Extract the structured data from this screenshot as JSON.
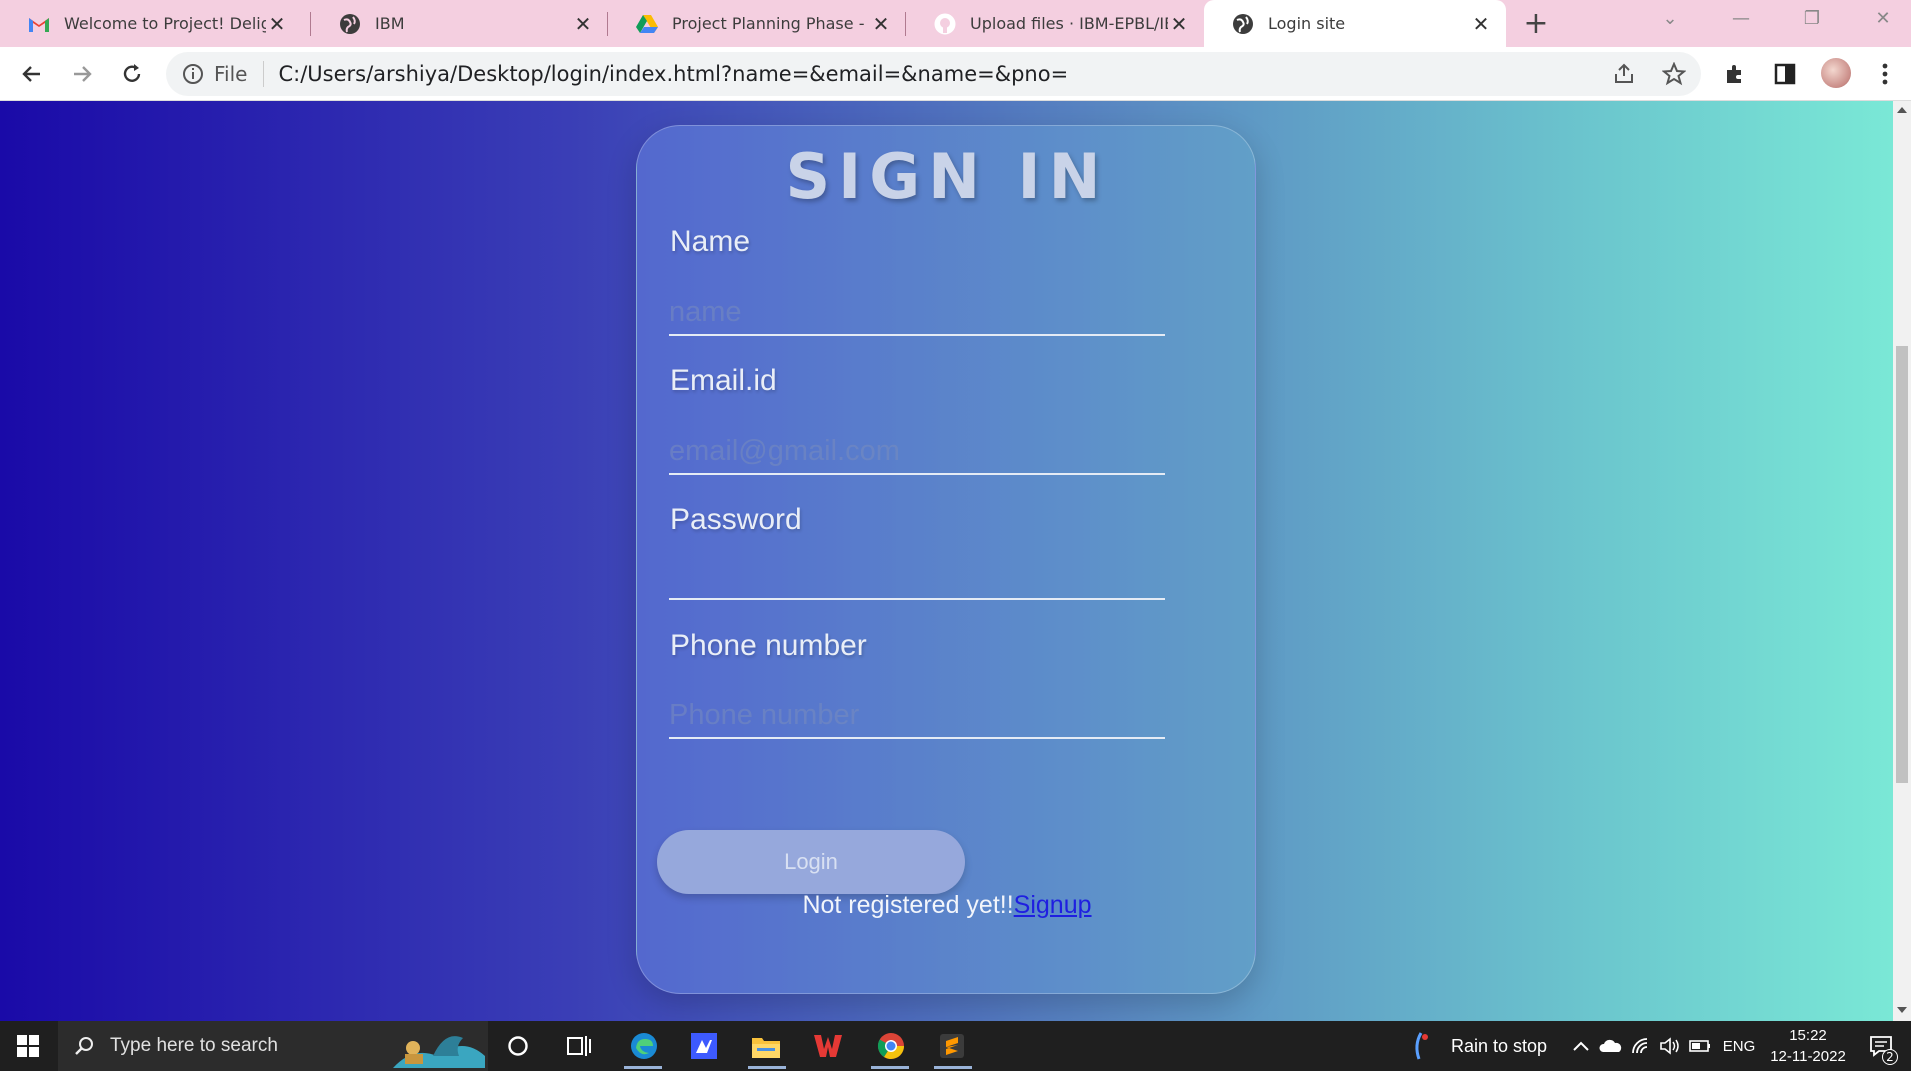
{
  "browser": {
    "tabs": [
      {
        "title": "Welcome to Project! Delighte",
        "favicon": "gmail-icon",
        "active": false
      },
      {
        "title": "IBM",
        "favicon": "globe-icon",
        "active": false
      },
      {
        "title": "Project Planning Phase - Goo",
        "favicon": "google-drive-icon",
        "active": false
      },
      {
        "title": "Upload files · IBM-EPBL/IBM-",
        "favicon": "github-icon",
        "active": false
      },
      {
        "title": "Login site",
        "favicon": "globe-icon",
        "active": true
      }
    ],
    "omnibox": {
      "scheme_label": "File",
      "url": "C:/Users/arshiya/Desktop/login/index.html?name=&email=&name=&pno="
    }
  },
  "form": {
    "title": "SIGN IN",
    "fields": [
      {
        "label": "Name",
        "placeholder": "name",
        "value": ""
      },
      {
        "label": "Email.id",
        "placeholder": "email@gmail.com",
        "value": ""
      },
      {
        "label": "Password",
        "placeholder": "",
        "value": ""
      },
      {
        "label": "Phone number",
        "placeholder": "Phone number",
        "value": ""
      }
    ],
    "login_label": "Login",
    "register_prompt": "Not registered yet!!",
    "signup_link": "Signup"
  },
  "taskbar": {
    "search_placeholder": "Type here to search",
    "weather": "Rain to stop",
    "language": "ENG",
    "time": "15:22",
    "date": "12-11-2022",
    "notification_count": "2"
  },
  "colors": {
    "tab_bar": "#f4cfe0",
    "gradient_left": "#1a0aa8",
    "gradient_right": "#7ae8d6",
    "signup_link": "#1f1fe0"
  }
}
